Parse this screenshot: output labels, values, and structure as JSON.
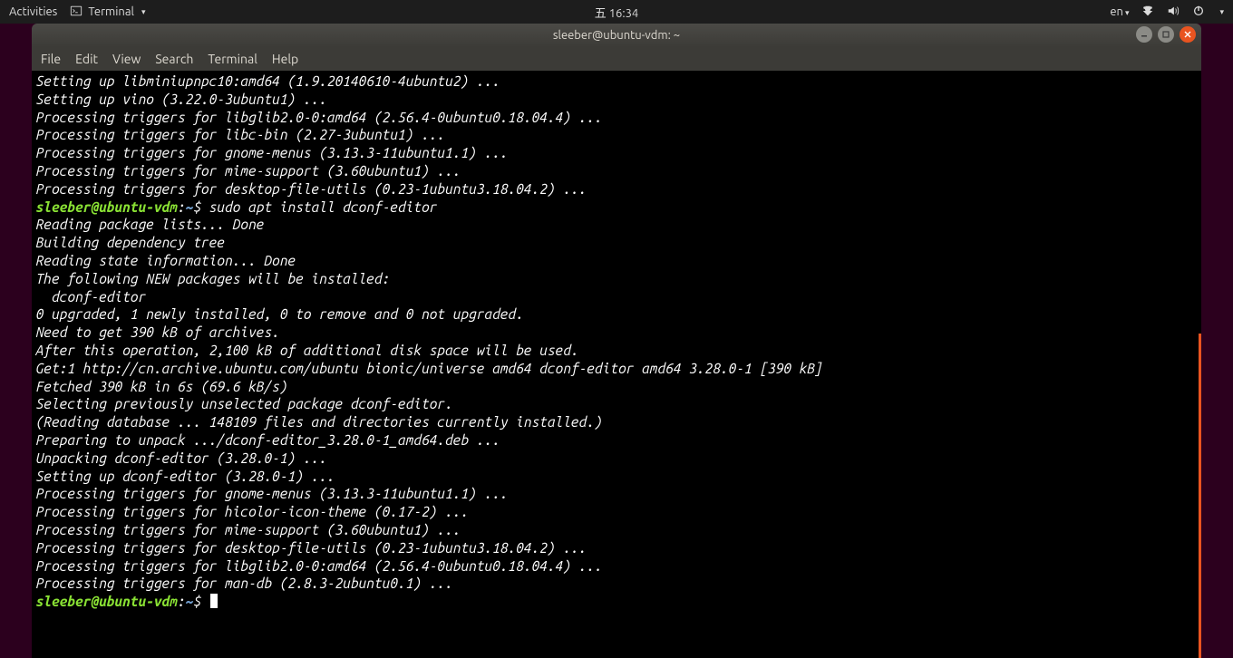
{
  "topbar": {
    "activities": "Activities",
    "app_name": "Terminal",
    "clock": "五 16:34",
    "lang": "en",
    "icons": [
      "network-icon",
      "sound-icon",
      "power-icon"
    ]
  },
  "window": {
    "title": "sleeber@ubuntu-vdm: ~"
  },
  "menubar": {
    "items": [
      "File",
      "Edit",
      "View",
      "Search",
      "Terminal",
      "Help"
    ]
  },
  "prompt": {
    "user_host": "sleeber@ubuntu-vdm",
    "sep": ":",
    "path": "~",
    "sigil": "$"
  },
  "terminal": {
    "pre_lines": [
      "Setting up libminiupnpc10:amd64 (1.9.20140610-4ubuntu2) ...",
      "Setting up vino (3.22.0-3ubuntu1) ...",
      "Processing triggers for libglib2.0-0:amd64 (2.56.4-0ubuntu0.18.04.4) ...",
      "Processing triggers for libc-bin (2.27-3ubuntu1) ...",
      "Processing triggers for gnome-menus (3.13.3-11ubuntu1.1) ...",
      "Processing triggers for mime-support (3.60ubuntu1) ...",
      "Processing triggers for desktop-file-utils (0.23-1ubuntu3.18.04.2) ..."
    ],
    "cmd1": " sudo apt install dconf-editor",
    "post_lines": [
      "Reading package lists... Done",
      "Building dependency tree",
      "Reading state information... Done",
      "The following NEW packages will be installed:",
      "  dconf-editor",
      "0 upgraded, 1 newly installed, 0 to remove and 0 not upgraded.",
      "Need to get 390 kB of archives.",
      "After this operation, 2,100 kB of additional disk space will be used.",
      "Get:1 http://cn.archive.ubuntu.com/ubuntu bionic/universe amd64 dconf-editor amd64 3.28.0-1 [390 kB]",
      "Fetched 390 kB in 6s (69.6 kB/s)",
      "Selecting previously unselected package dconf-editor.",
      "(Reading database ... 148109 files and directories currently installed.)",
      "Preparing to unpack .../dconf-editor_3.28.0-1_amd64.deb ...",
      "Unpacking dconf-editor (3.28.0-1) ...",
      "Setting up dconf-editor (3.28.0-1) ...",
      "Processing triggers for gnome-menus (3.13.3-11ubuntu1.1) ...",
      "Processing triggers for hicolor-icon-theme (0.17-2) ...",
      "Processing triggers for mime-support (3.60ubuntu1) ...",
      "Processing triggers for desktop-file-utils (0.23-1ubuntu3.18.04.2) ...",
      "Processing triggers for libglib2.0-0:amd64 (2.56.4-0ubuntu0.18.04.4) ...",
      "Processing triggers for man-db (2.8.3-2ubuntu0.1) ..."
    ]
  }
}
